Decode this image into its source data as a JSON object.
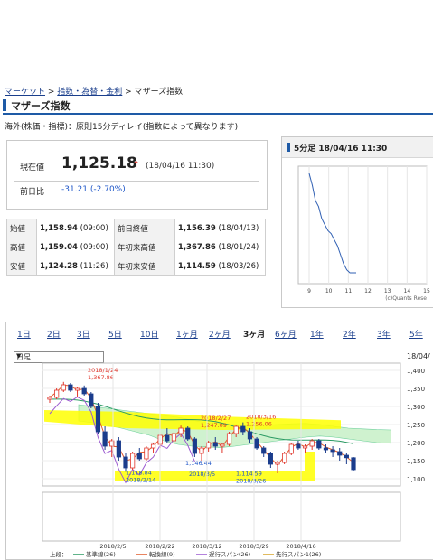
{
  "breadcrumb": {
    "items": [
      "マーケット",
      "指数・為替・金利",
      "マザーズ指数"
    ],
    "sep": " > "
  },
  "page": {
    "title": "マザーズ指数",
    "notice": "海外(株価・指標)：原則15分ディレイ(指数によって異なります)"
  },
  "quote": {
    "current_label": "現在値",
    "price": "1,125.18",
    "arrow": "↑",
    "time": "(18/04/16 11:30)",
    "change_label": "前日比",
    "change": "-31.21 (-2.70%)"
  },
  "stats": [
    [
      "始値",
      "1,158.94",
      "(09:00)",
      "前日終値",
      "1,156.39",
      "(18/04/13)"
    ],
    [
      "高値",
      "1,159.04",
      "(09:00)",
      "年初来高値",
      "1,367.86",
      "(18/01/24)"
    ],
    [
      "安値",
      "1,124.28",
      "(11:26)",
      "年初来安値",
      "1,114.59",
      "(18/03/26)"
    ]
  ],
  "mini_chart": {
    "title": "5分足 18/04/16 11:30",
    "x_ticks": [
      "9",
      "10",
      "11",
      "12",
      "13",
      "14",
      "15"
    ],
    "credit": "(c)Quants Rese",
    "values": [
      1158,
      1154,
      1149,
      1147,
      1143,
      1141,
      1139,
      1138,
      1136,
      1134,
      1131,
      1128,
      1126,
      1125,
      1125,
      1125
    ],
    "line_color": "#2f5fb3"
  },
  "ranges": {
    "tabs": [
      "1日",
      "2日",
      "3日",
      "5日",
      "10日",
      "1ヶ月",
      "2ヶ月",
      "3ヶ月",
      "6ヶ月",
      "1年",
      "2年",
      "3年",
      "5年"
    ],
    "active": "3ヶ月",
    "select_value": "日足",
    "date": "18/04/"
  },
  "chart_data": {
    "type": "candlestick",
    "y_ticks": [
      "1,400",
      "1,350",
      "1,300",
      "1,250",
      "1,200",
      "1,150",
      "1,100"
    ],
    "x_ticks": [
      "2018/2/5",
      "2018/2/22",
      "2018/3/12",
      "2018/3/29",
      "2018/4/16"
    ],
    "annotations": [
      {
        "date": "2018/1/24",
        "value": "1,367.86"
      },
      {
        "date": "2018/2/27",
        "value": "1,247.09"
      },
      {
        "date": "2018/3/16",
        "value": "1,256.06"
      },
      {
        "value": "1,146.44"
      },
      {
        "value": "1,118.84",
        "date": "2018/2/14"
      },
      {
        "date": "2018/3/5"
      },
      {
        "value": "1,114.59",
        "date": "2018/3/26"
      }
    ],
    "legend_title": "上段：",
    "legend": [
      {
        "name": "基準線(26)",
        "color": "#2a9a63"
      },
      {
        "name": "転換線(9)",
        "color": "#e05a2a"
      },
      {
        "name": "遅行スパン(26)",
        "color": "#9b59d0"
      },
      {
        "name": "先行スパン1(26)",
        "color": "#d7a429"
      },
      {
        "name": "先行スパン2(26)",
        "color": "#62c4b4"
      }
    ],
    "candles": [
      [
        1320,
        1330,
        1310,
        1325
      ],
      [
        1325,
        1350,
        1320,
        1345
      ],
      [
        1345,
        1368,
        1340,
        1360
      ],
      [
        1360,
        1365,
        1340,
        1345
      ],
      [
        1345,
        1355,
        1325,
        1350
      ],
      [
        1350,
        1358,
        1330,
        1335
      ],
      [
        1335,
        1340,
        1295,
        1300
      ],
      [
        1300,
        1310,
        1225,
        1230
      ],
      [
        1230,
        1245,
        1180,
        1190
      ],
      [
        1190,
        1210,
        1160,
        1205
      ],
      [
        1205,
        1215,
        1150,
        1160
      ],
      [
        1160,
        1170,
        1119,
        1130
      ],
      [
        1130,
        1175,
        1125,
        1170
      ],
      [
        1170,
        1185,
        1150,
        1155
      ],
      [
        1155,
        1190,
        1150,
        1185
      ],
      [
        1185,
        1200,
        1170,
        1195
      ],
      [
        1195,
        1225,
        1185,
        1220
      ],
      [
        1220,
        1240,
        1200,
        1205
      ],
      [
        1205,
        1230,
        1195,
        1225
      ],
      [
        1225,
        1247,
        1215,
        1240
      ],
      [
        1240,
        1245,
        1205,
        1210
      ],
      [
        1210,
        1215,
        1160,
        1170
      ],
      [
        1170,
        1190,
        1150,
        1185
      ],
      [
        1185,
        1205,
        1175,
        1200
      ],
      [
        1200,
        1215,
        1180,
        1190
      ],
      [
        1190,
        1200,
        1170,
        1195
      ],
      [
        1195,
        1230,
        1190,
        1225
      ],
      [
        1225,
        1250,
        1215,
        1245
      ],
      [
        1245,
        1256,
        1220,
        1230
      ],
      [
        1230,
        1240,
        1200,
        1210
      ],
      [
        1210,
        1215,
        1180,
        1185
      ],
      [
        1185,
        1190,
        1160,
        1170
      ],
      [
        1170,
        1175,
        1130,
        1140
      ],
      [
        1140,
        1150,
        1115,
        1145
      ],
      [
        1145,
        1175,
        1140,
        1170
      ],
      [
        1170,
        1200,
        1165,
        1195
      ],
      [
        1195,
        1205,
        1180,
        1185
      ],
      [
        1185,
        1195,
        1170,
        1190
      ],
      [
        1190,
        1210,
        1180,
        1205
      ],
      [
        1205,
        1210,
        1180,
        1185
      ],
      [
        1185,
        1195,
        1170,
        1180
      ],
      [
        1180,
        1190,
        1160,
        1175
      ],
      [
        1175,
        1185,
        1150,
        1165
      ],
      [
        1165,
        1170,
        1140,
        1158
      ],
      [
        1158,
        1160,
        1120,
        1125
      ]
    ],
    "highlight_color": "#ffff00",
    "ylim": [
      1080,
      1420
    ]
  }
}
